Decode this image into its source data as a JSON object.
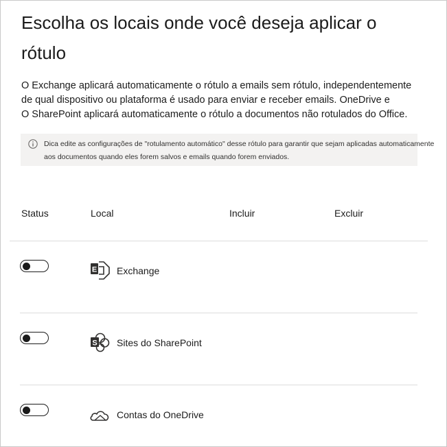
{
  "heading": {
    "title": "Escolha os locais onde você deseja aplicar o rótulo"
  },
  "description": {
    "line1": "O Exchange aplicará automaticamente o rótulo a emails sem rótulo, independentemente",
    "line2": "de qual dispositivo ou plataforma é usado para enviar e receber emails. OneDrive e",
    "line3": "O SharePoint aplicará automaticamente o rótulo a documentos não rotulados do Office."
  },
  "tip": {
    "icon": "info-icon",
    "text": "Dica edite as configurações de \"rotulamento automático\" desse rótulo para garantir que sejam aplicadas automaticamente aos documentos quando eles forem salvos e emails quando forem enviados."
  },
  "table": {
    "headers": {
      "status": "Status",
      "local": "Local",
      "incluir": "Incluir",
      "excluir": "Excluir"
    },
    "rows": [
      {
        "label": "Exchange",
        "icon": "exchange-icon",
        "enabled": false
      },
      {
        "label": "Sites do SharePoint",
        "icon": "sharepoint-icon",
        "enabled": false
      },
      {
        "label": "Contas do OneDrive",
        "icon": "onedrive-icon",
        "enabled": false
      }
    ]
  }
}
